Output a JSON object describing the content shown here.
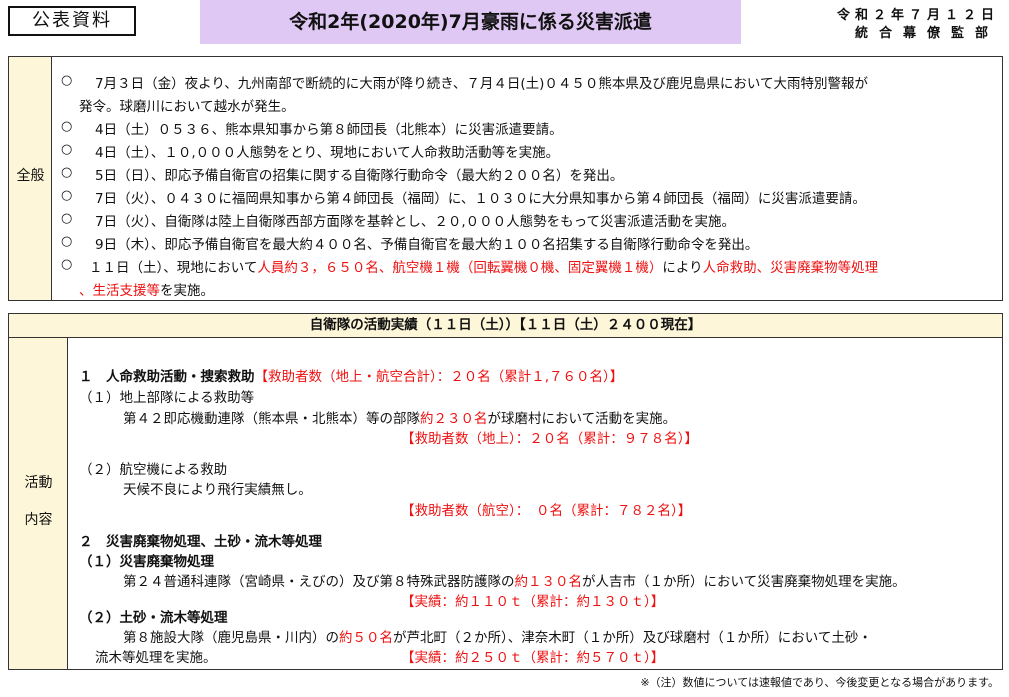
{
  "header": {
    "public_label": "公表資料",
    "title": "令和2年(2020年)7月豪雨に係る災害派遣",
    "date": "令和２年７月１２日",
    "org": "統合幕僚監部"
  },
  "overview": {
    "side_label": "全般",
    "bullet": "○",
    "items": [
      {
        "a": "7月３日（金）夜より、九州南部で断続的に大雨が降り続き、７月４日(土)０４５０熊本県及び鹿児島県において大雨特別警報が",
        "b": "発令。球磨川において越水が発生。"
      },
      {
        "a": "4日（土）０５３６、熊本県知事から第８師団長（北熊本）に災害派遣要請。"
      },
      {
        "a": "4日（土）、１０,０００人態勢をとり、現地において人命救助活動等を実施。"
      },
      {
        "a": "5日（日）、即応予備自衛官の招集に関する自衛隊行動命令（最大約２００名）を発出。"
      },
      {
        "a": "7日（火）、０４３０に福岡県知事から第４師団長（福岡）に、１０３０に大分県知事から第４師団長（福岡）に災害派遣要請。"
      },
      {
        "a": "7日（火）、自衛隊は陸上自衛隊西部方面隊を基幹とし、２０,０００人態勢をもって災害派遣活動を実施。"
      },
      {
        "a": "9日（木）、即応予備自衛官を最大約４００名、予備自衛官を最大約１００名招集する自衛隊行動命令を発出。"
      },
      {
        "a": "１１日（土）、現地において",
        "a_red": "人員約３，６５０名、航空機１機（回転翼機０機、固定翼機１機）",
        "a_tail": "により",
        "a_red2": "人命救助、災害廃棄物等処理",
        "b_red": "、生活支援等",
        "b": "を実施。"
      }
    ]
  },
  "activity": {
    "heading": "自衛隊の活動実績（１１日（土））【１１日（土）２４００現在】",
    "side_label_1": "活動",
    "side_label_2": "内容",
    "s1_title": "１　人命救助活動・捜索救助",
    "s1_total": "【救助者数（地上・航空合計）：２０名（累計１,７６０名）】",
    "s1_1_title": "（１）地上部隊による救助等",
    "s1_1_text_a": "第４２即応機動連隊（熊本県・北熊本）等の部隊",
    "s1_1_text_red": "約２３０名",
    "s1_1_text_b": "が球磨村において活動を実施。",
    "s1_1_result": "【救助者数（地上）：２０名（累計：９７８名）】",
    "s1_2_title": "（２）航空機による救助",
    "s1_2_text": "天候不良により飛行実績無し。",
    "s1_2_result": "【救助者数（航空）：　０名（累計：７８２名）】",
    "s2_title": "２　災害廃棄物処理、土砂・流木等処理",
    "s2_1_title": "（１）災害廃棄物処理",
    "s2_1_text_a": "第２４普通科連隊（宮崎県・えびの）及び第８特殊武器防護隊の",
    "s2_1_text_red": "約１３０名",
    "s2_1_text_b": "が人吉市（１か所）において災害廃棄物処理を実施。",
    "s2_1_result": "【実績：約１１０ｔ（累計：約１３０ｔ）】",
    "s2_2_title": "（２）土砂・流木等処理",
    "s2_2_text_a": "第８施設大隊（鹿児島県・川内）の",
    "s2_2_text_red": "約５０名",
    "s2_2_text_b": "が芦北町（２か所）、津奈木町（１か所）及び球磨村（１か所）において土砂・",
    "s2_2_text_c": "流木等処理を実施。",
    "s2_2_result": "【実績：約２５０ｔ（累計：約５７０ｔ）】"
  },
  "footnote": "※（注）数値については速報値であり、今後変更となる場合があります。",
  "colors": {
    "title_bg": "#e0c8f4",
    "side_bg": "#fef6d8",
    "red": "#ee1111"
  }
}
